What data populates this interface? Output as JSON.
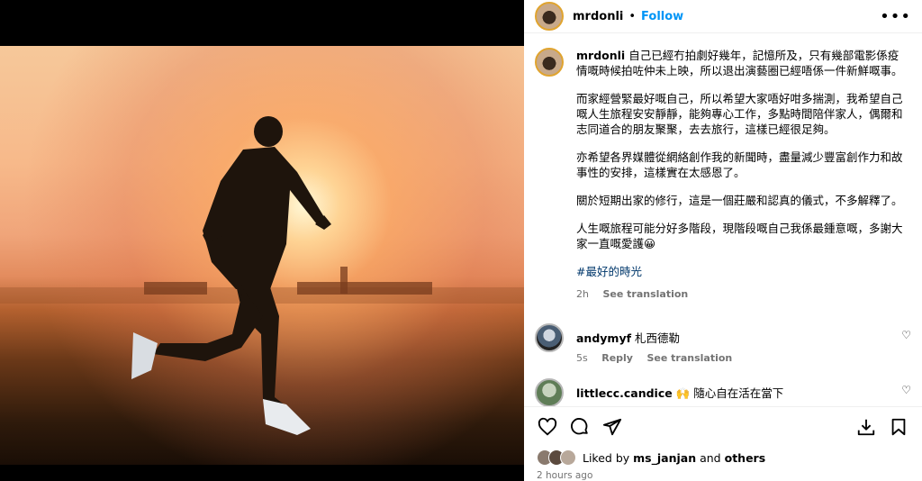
{
  "post": {
    "username": "mrdonli",
    "dot": "•",
    "follow_label": "Follow",
    "more_icon": "more-horizontal-icon"
  },
  "caption": {
    "username": "mrdonli",
    "para1": "自己已經冇拍劇好幾年，記憶所及，只有幾部電影係疫情嘅時候拍咗仲未上映，所以退出演藝圈已經唔係一件新鮮嘅事。",
    "para2": "而家經營緊最好嘅自己，所以希望大家唔好咁多揣測，我希望自己嘅人生旅程安安靜靜，能夠專心工作，多點時間陪伴家人，偶爾和志同道合的朋友聚聚，去去旅行，這樣已經很足夠。",
    "para3": "亦希望各界媒體從網絡創作我的新聞時，盡量減少豐富創作力和故事性的安排，這樣實在太感恩了。",
    "para4": "關於短期出家的修行，這是一個莊嚴和認真的儀式，不多解釋了。",
    "para5": "人生嘅旅程可能分好多階段，現階段嘅自己我係最鍾意嘅，多謝大家一直嘅愛護😀",
    "hashtag": "#最好的時光",
    "age": "2h",
    "see_translation": "See translation"
  },
  "comments": [
    {
      "username": "andymyf",
      "text": "札西德勒",
      "age": "5s",
      "reply": "Reply",
      "see_translation": "See translation"
    },
    {
      "username": "littlecc.candice",
      "text": "🙌 隨心自在活在當下"
    }
  ],
  "actions": {
    "like_icon": "heart-icon",
    "comment_icon": "comment-icon",
    "share_icon": "share-icon",
    "download_icon": "download-icon",
    "save_icon": "bookmark-icon"
  },
  "likes": {
    "prefix": "Liked by",
    "user": "ms_janjan",
    "and": "and",
    "others": "others"
  },
  "timestamp": "2 hours ago"
}
